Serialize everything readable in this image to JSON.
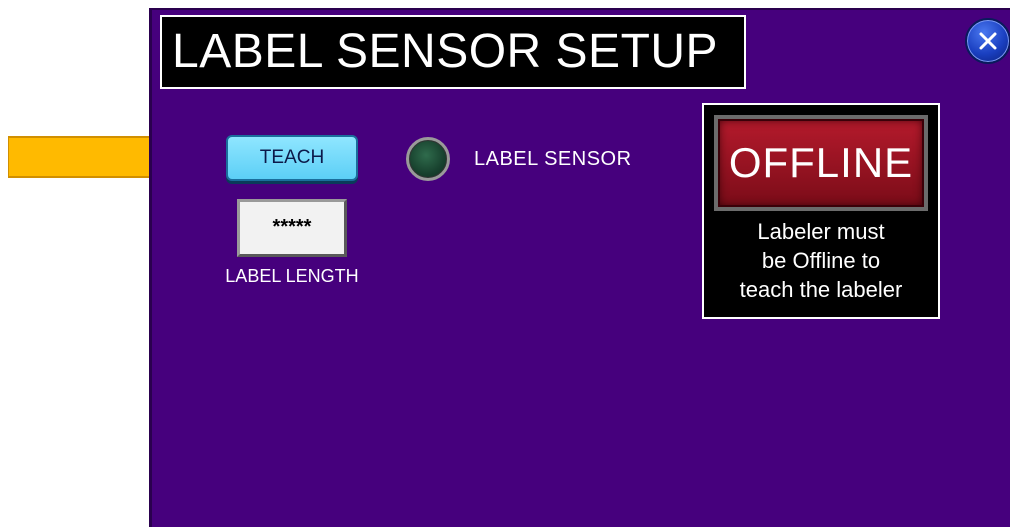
{
  "title": "LABEL SENSOR SETUP",
  "close_button": {
    "icon": "close-icon"
  },
  "teach_button": {
    "label": "TEACH"
  },
  "label_length": {
    "value": "*****",
    "caption": "LABEL LENGTH"
  },
  "sensor": {
    "label": "LABEL SENSOR",
    "led_color": "#17402d"
  },
  "offline": {
    "button_label": "OFFLINE",
    "message_lines": [
      "Labeler must",
      "be Offline to",
      "teach the labeler"
    ]
  },
  "pointer_arrow": {
    "icon": "arrow-right-icon",
    "color": "#ffba00"
  },
  "colors": {
    "panel_bg": "#46007d",
    "accent": "#5ccff6",
    "offline_red": "#9a1424"
  }
}
